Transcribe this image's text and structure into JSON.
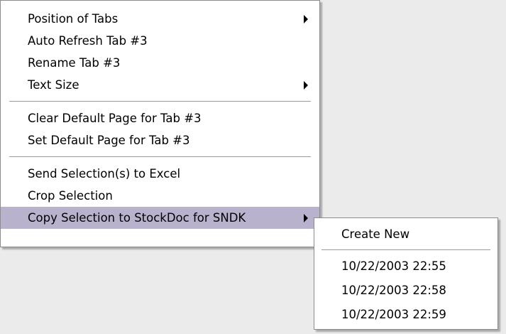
{
  "main_menu": {
    "items": [
      {
        "label": "Position of Tabs",
        "submenu": true
      },
      {
        "label": "Auto Refresh Tab #3"
      },
      {
        "label": "Rename Tab #3"
      },
      {
        "label": "Text Size",
        "submenu": true
      },
      {
        "label": "Clear Default Page for Tab #3"
      },
      {
        "label": "Set Default Page for Tab #3"
      },
      {
        "label": "Send Selection(s) to Excel"
      },
      {
        "label": "Crop Selection"
      },
      {
        "label": "Copy Selection to StockDoc for SNDK",
        "submenu": true,
        "highlighted": true
      }
    ]
  },
  "sub_menu": {
    "items": [
      {
        "label": "Create New"
      },
      {
        "label": "10/22/2003 22:55"
      },
      {
        "label": "10/22/2003 22:58"
      },
      {
        "label": "10/22/2003 22:59"
      }
    ]
  },
  "colors": {
    "background": "#ebebeb",
    "menu_background": "#ffffff",
    "highlight": "#b8b2cd",
    "separator": "#9a9a9a"
  },
  "icons": {
    "submenu_arrow": "triangle-right-icon"
  }
}
